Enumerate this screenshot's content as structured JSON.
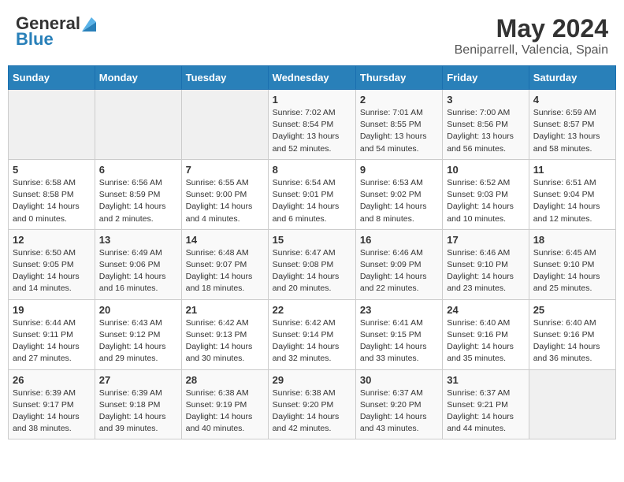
{
  "header": {
    "logo_line1": "General",
    "logo_line2": "Blue",
    "main_title": "May 2024",
    "subtitle": "Beniparrell, Valencia, Spain"
  },
  "days_of_week": [
    "Sunday",
    "Monday",
    "Tuesday",
    "Wednesday",
    "Thursday",
    "Friday",
    "Saturday"
  ],
  "weeks": [
    [
      {
        "day": "",
        "info": ""
      },
      {
        "day": "",
        "info": ""
      },
      {
        "day": "",
        "info": ""
      },
      {
        "day": "1",
        "info": "Sunrise: 7:02 AM\nSunset: 8:54 PM\nDaylight: 13 hours and 52 minutes."
      },
      {
        "day": "2",
        "info": "Sunrise: 7:01 AM\nSunset: 8:55 PM\nDaylight: 13 hours and 54 minutes."
      },
      {
        "day": "3",
        "info": "Sunrise: 7:00 AM\nSunset: 8:56 PM\nDaylight: 13 hours and 56 minutes."
      },
      {
        "day": "4",
        "info": "Sunrise: 6:59 AM\nSunset: 8:57 PM\nDaylight: 13 hours and 58 minutes."
      }
    ],
    [
      {
        "day": "5",
        "info": "Sunrise: 6:58 AM\nSunset: 8:58 PM\nDaylight: 14 hours and 0 minutes."
      },
      {
        "day": "6",
        "info": "Sunrise: 6:56 AM\nSunset: 8:59 PM\nDaylight: 14 hours and 2 minutes."
      },
      {
        "day": "7",
        "info": "Sunrise: 6:55 AM\nSunset: 9:00 PM\nDaylight: 14 hours and 4 minutes."
      },
      {
        "day": "8",
        "info": "Sunrise: 6:54 AM\nSunset: 9:01 PM\nDaylight: 14 hours and 6 minutes."
      },
      {
        "day": "9",
        "info": "Sunrise: 6:53 AM\nSunset: 9:02 PM\nDaylight: 14 hours and 8 minutes."
      },
      {
        "day": "10",
        "info": "Sunrise: 6:52 AM\nSunset: 9:03 PM\nDaylight: 14 hours and 10 minutes."
      },
      {
        "day": "11",
        "info": "Sunrise: 6:51 AM\nSunset: 9:04 PM\nDaylight: 14 hours and 12 minutes."
      }
    ],
    [
      {
        "day": "12",
        "info": "Sunrise: 6:50 AM\nSunset: 9:05 PM\nDaylight: 14 hours and 14 minutes."
      },
      {
        "day": "13",
        "info": "Sunrise: 6:49 AM\nSunset: 9:06 PM\nDaylight: 14 hours and 16 minutes."
      },
      {
        "day": "14",
        "info": "Sunrise: 6:48 AM\nSunset: 9:07 PM\nDaylight: 14 hours and 18 minutes."
      },
      {
        "day": "15",
        "info": "Sunrise: 6:47 AM\nSunset: 9:08 PM\nDaylight: 14 hours and 20 minutes."
      },
      {
        "day": "16",
        "info": "Sunrise: 6:46 AM\nSunset: 9:09 PM\nDaylight: 14 hours and 22 minutes."
      },
      {
        "day": "17",
        "info": "Sunrise: 6:46 AM\nSunset: 9:10 PM\nDaylight: 14 hours and 23 minutes."
      },
      {
        "day": "18",
        "info": "Sunrise: 6:45 AM\nSunset: 9:10 PM\nDaylight: 14 hours and 25 minutes."
      }
    ],
    [
      {
        "day": "19",
        "info": "Sunrise: 6:44 AM\nSunset: 9:11 PM\nDaylight: 14 hours and 27 minutes."
      },
      {
        "day": "20",
        "info": "Sunrise: 6:43 AM\nSunset: 9:12 PM\nDaylight: 14 hours and 29 minutes."
      },
      {
        "day": "21",
        "info": "Sunrise: 6:42 AM\nSunset: 9:13 PM\nDaylight: 14 hours and 30 minutes."
      },
      {
        "day": "22",
        "info": "Sunrise: 6:42 AM\nSunset: 9:14 PM\nDaylight: 14 hours and 32 minutes."
      },
      {
        "day": "23",
        "info": "Sunrise: 6:41 AM\nSunset: 9:15 PM\nDaylight: 14 hours and 33 minutes."
      },
      {
        "day": "24",
        "info": "Sunrise: 6:40 AM\nSunset: 9:16 PM\nDaylight: 14 hours and 35 minutes."
      },
      {
        "day": "25",
        "info": "Sunrise: 6:40 AM\nSunset: 9:16 PM\nDaylight: 14 hours and 36 minutes."
      }
    ],
    [
      {
        "day": "26",
        "info": "Sunrise: 6:39 AM\nSunset: 9:17 PM\nDaylight: 14 hours and 38 minutes."
      },
      {
        "day": "27",
        "info": "Sunrise: 6:39 AM\nSunset: 9:18 PM\nDaylight: 14 hours and 39 minutes."
      },
      {
        "day": "28",
        "info": "Sunrise: 6:38 AM\nSunset: 9:19 PM\nDaylight: 14 hours and 40 minutes."
      },
      {
        "day": "29",
        "info": "Sunrise: 6:38 AM\nSunset: 9:20 PM\nDaylight: 14 hours and 42 minutes."
      },
      {
        "day": "30",
        "info": "Sunrise: 6:37 AM\nSunset: 9:20 PM\nDaylight: 14 hours and 43 minutes."
      },
      {
        "day": "31",
        "info": "Sunrise: 6:37 AM\nSunset: 9:21 PM\nDaylight: 14 hours and 44 minutes."
      },
      {
        "day": "",
        "info": ""
      }
    ]
  ],
  "colors": {
    "header_bg": "#2980b9",
    "header_text": "#ffffff",
    "accent_blue": "#1a6faf"
  }
}
